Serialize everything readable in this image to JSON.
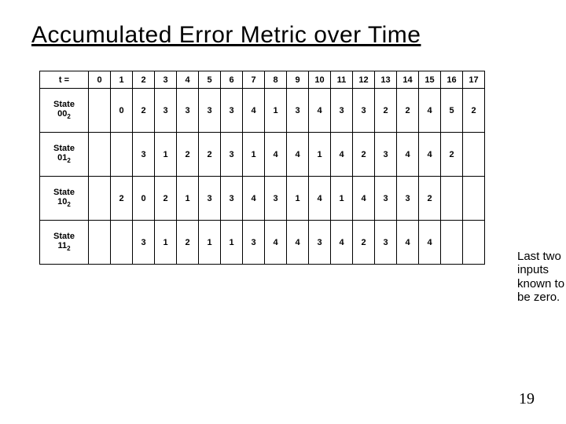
{
  "title": "Accumulated Error Metric over Time",
  "header_label": "t =",
  "t_values": [
    "0",
    "1",
    "2",
    "3",
    "4",
    "5",
    "6",
    "7",
    "8",
    "9",
    "10",
    "11",
    "12",
    "13",
    "14",
    "15",
    "16",
    "17"
  ],
  "rows": [
    {
      "name": "State",
      "sub": "00",
      "sub2": "2",
      "values": [
        "",
        "0",
        "2",
        "3",
        "3",
        "3",
        "3",
        "4",
        "1",
        "3",
        "4",
        "3",
        "3",
        "2",
        "2",
        "4",
        "5",
        "2"
      ]
    },
    {
      "name": "State",
      "sub": "01",
      "sub2": "2",
      "values": [
        "",
        "",
        "3",
        "1",
        "2",
        "2",
        "3",
        "1",
        "4",
        "4",
        "1",
        "4",
        "2",
        "3",
        "4",
        "4",
        "2",
        ""
      ]
    },
    {
      "name": "State",
      "sub": "10",
      "sub2": "2",
      "values": [
        "",
        "2",
        "0",
        "2",
        "1",
        "3",
        "3",
        "4",
        "3",
        "1",
        "4",
        "1",
        "4",
        "3",
        "3",
        "2",
        "",
        ""
      ]
    },
    {
      "name": "State",
      "sub": "11",
      "sub2": "2",
      "values": [
        "",
        "",
        "3",
        "1",
        "2",
        "1",
        "1",
        "3",
        "4",
        "4",
        "3",
        "4",
        "2",
        "3",
        "4",
        "4",
        "",
        ""
      ]
    }
  ],
  "note": "Last two inputs known to be zero.",
  "page_number": "19",
  "chart_data": {
    "type": "table",
    "title": "Accumulated Error Metric over Time",
    "columns": [
      "t=0",
      "t=1",
      "t=2",
      "t=3",
      "t=4",
      "t=5",
      "t=6",
      "t=7",
      "t=8",
      "t=9",
      "t=10",
      "t=11",
      "t=12",
      "t=13",
      "t=14",
      "t=15",
      "t=16",
      "t=17"
    ],
    "rows": {
      "State 00_2": [
        null,
        0,
        2,
        3,
        3,
        3,
        3,
        4,
        1,
        3,
        4,
        3,
        3,
        2,
        2,
        4,
        5,
        2
      ],
      "State 01_2": [
        null,
        null,
        3,
        1,
        2,
        2,
        3,
        1,
        4,
        4,
        1,
        4,
        2,
        3,
        4,
        4,
        2,
        null
      ],
      "State 10_2": [
        null,
        2,
        0,
        2,
        1,
        3,
        3,
        4,
        3,
        1,
        4,
        1,
        4,
        3,
        3,
        2,
        null,
        null
      ],
      "State 11_2": [
        null,
        null,
        3,
        1,
        2,
        1,
        1,
        3,
        4,
        4,
        3,
        4,
        2,
        3,
        4,
        4,
        null,
        null
      ]
    }
  }
}
